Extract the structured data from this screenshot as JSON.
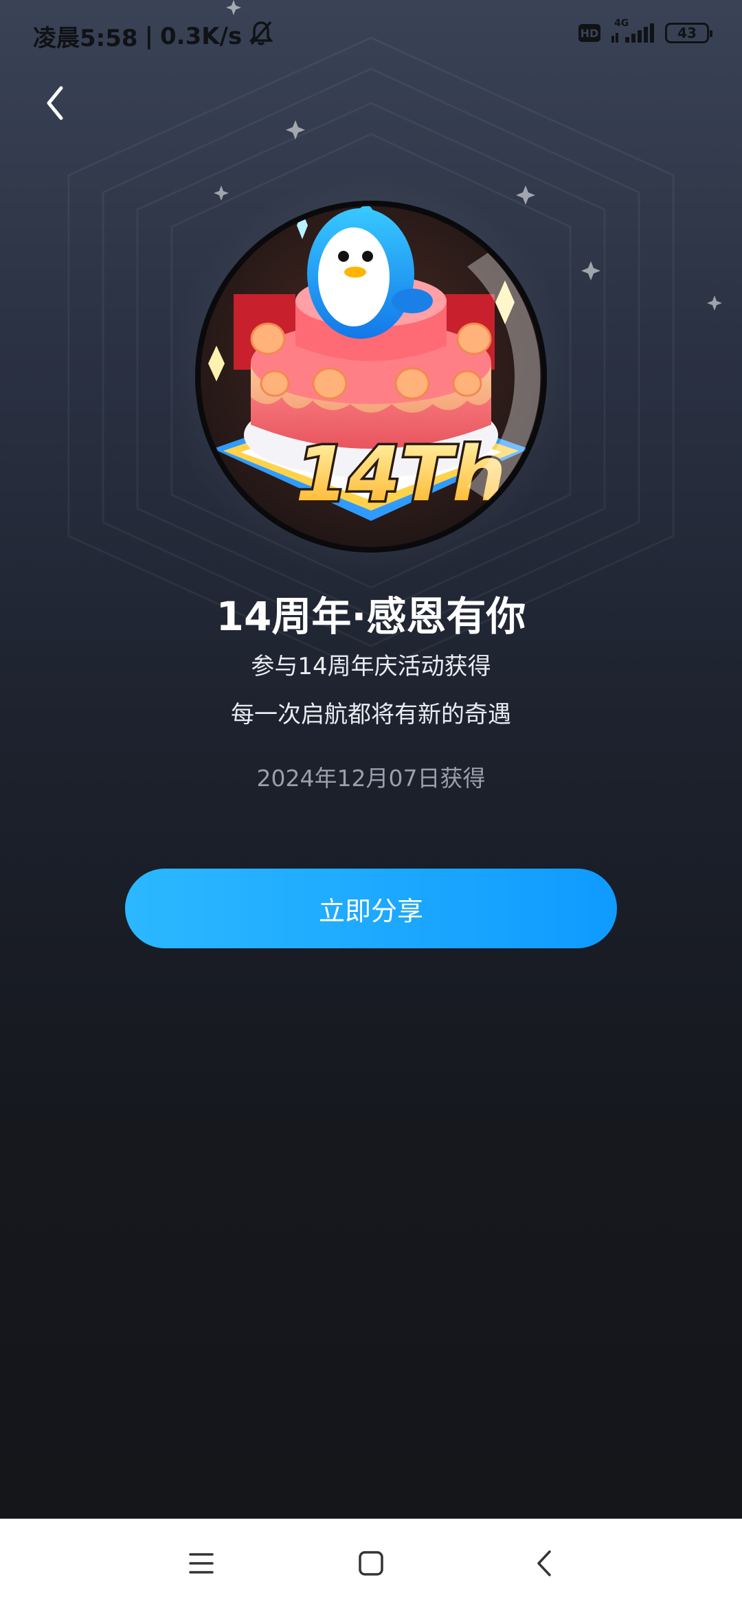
{
  "status_bar": {
    "time": "凌晨5:58",
    "separator": "|",
    "speed": "0.3K/s",
    "hd": "HD",
    "network": "4G",
    "battery": "43"
  },
  "badge": {
    "title": "14周年·感恩有你",
    "line1": "参与14周年庆活动获得",
    "line2": "每一次启航都将有新的奇遇",
    "date": "2024年12月07日获得",
    "emblem_text": "14Th"
  },
  "share_button": {
    "label": "立即分享"
  },
  "icons": [
    "back-icon",
    "mute-bell-icon",
    "signal-icon",
    "battery-icon",
    "menu-icon",
    "home-icon",
    "nav-back-icon"
  ],
  "colors": {
    "accent": "#1aa9ff",
    "background_top": "#3a4356",
    "background_bottom": "#141519"
  }
}
